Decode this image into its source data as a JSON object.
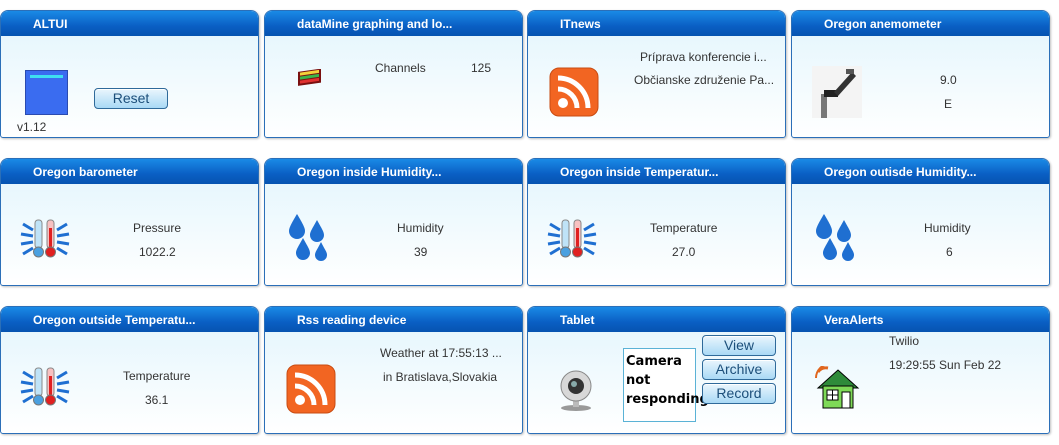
{
  "tiles": [
    {
      "title": "ALTUI",
      "reset": "Reset",
      "version": "v1.12"
    },
    {
      "title": "dataMine graphing and lo...",
      "label": "Channels",
      "value": "125"
    },
    {
      "title": "ITnews",
      "line1": "Príprava konferencie i...",
      "line2": "Občianske združenie Pa..."
    },
    {
      "title": "Oregon anemometer",
      "line1": "9.0",
      "line2": "E"
    },
    {
      "title": "Oregon barometer",
      "label": "Pressure",
      "value": "1022.2"
    },
    {
      "title": "Oregon inside Humidity...",
      "label": "Humidity",
      "value": "39"
    },
    {
      "title": "Oregon inside Temperatur...",
      "label": "Temperature",
      "value": "27.0"
    },
    {
      "title": "Oregon outisde Humidity...",
      "label": "Humidity",
      "value": "6"
    },
    {
      "title": "Oregon outside Temperatu...",
      "label": "Temperature",
      "value": "36.1"
    },
    {
      "title": "Rss reading device",
      "line1": "Weather at 17:55:13 ...",
      "line2": "in Bratislava,Slovakia"
    },
    {
      "title": "Tablet",
      "camera_text": "Camera not responding",
      "view": "View",
      "archive": "Archive",
      "record": "Record"
    },
    {
      "title": "VeraAlerts",
      "line1": "Twilio",
      "line2": "19:29:55 Sun Feb 22"
    }
  ],
  "colors": {
    "header": "#0a5fc4",
    "rss": "#f26522",
    "water": "#1f6fd1",
    "house": "#2e8b3a"
  }
}
